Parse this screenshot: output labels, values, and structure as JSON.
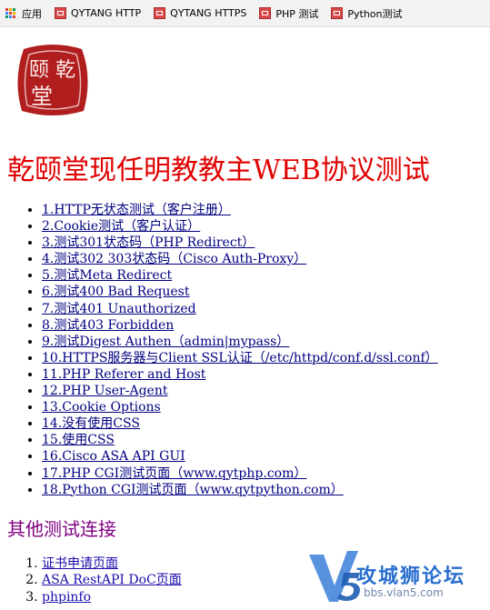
{
  "bookmarks": [
    {
      "label": "应用",
      "icon": "apps-grid-icon"
    },
    {
      "label": "QYTANG HTTP",
      "icon": "site-favicon-icon"
    },
    {
      "label": "QYTANG HTTPS",
      "icon": "site-favicon-icon"
    },
    {
      "label": "PHP 测试",
      "icon": "site-favicon-icon"
    },
    {
      "label": "Python测试",
      "icon": "site-favicon-icon"
    }
  ],
  "page": {
    "title": "乾颐堂现任明教教主WEB协议测试",
    "links": [
      "1.HTTP无状态测试（客户注册）",
      "2.Cookie测试（客户认证）",
      "3.测试301状态码（PHP Redirect）",
      "4.测试302 303状态码（Cisco Auth-Proxy）",
      "5.测试Meta Redirect",
      "6.测试400 Bad Request",
      "7.测试401 Unauthorized",
      "8.测试403 Forbidden",
      "9.测试Digest Authen（admin|mypass）",
      "10.HTTPS服务器与Client SSL认证（/etc/httpd/conf.d/ssl.conf）",
      "11.PHP Referer and Host",
      "12.PHP User-Agent",
      "13.Cookie Options",
      "14.没有使用CSS",
      "15.使用CSS",
      "16.Cisco ASA API GUI",
      "17.PHP CGI测试页面（www.qytphp.com）",
      "18.Python CGI测试页面（www.qytpython.com）"
    ],
    "other_heading": "其他测试连接",
    "other_links": [
      "证书申请页面",
      "ASA RestAPI DoC页面",
      "phpinfo"
    ]
  },
  "watermark": {
    "name": "攻城狮论坛",
    "url": "bbs.vlan5.com"
  },
  "colors": {
    "title": "#e00000",
    "heading": "#800080",
    "link": "#000080"
  }
}
